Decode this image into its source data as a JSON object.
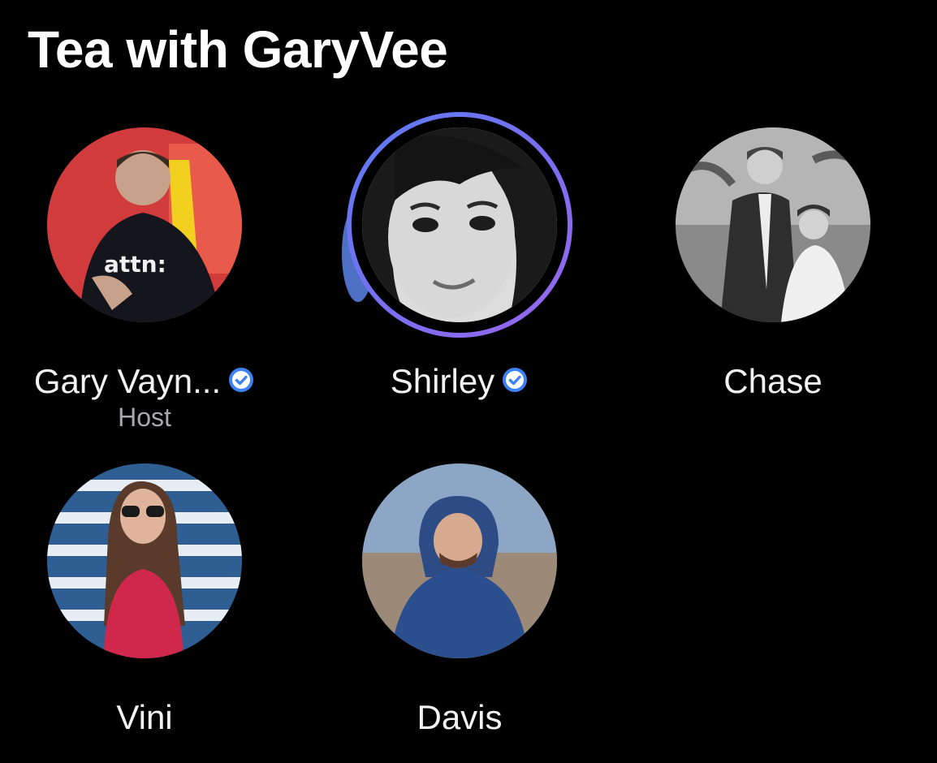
{
  "room": {
    "title": "Tea with GaryVee"
  },
  "colors": {
    "background": "#000000",
    "text": "#f2f2f2",
    "secondary_text": "#a9a9ad",
    "verified_badge": "#3b82f6",
    "speaking_ring": "#7b6ef0"
  },
  "speakers": [
    {
      "name": "Gary Vayn...",
      "verified": true,
      "role": "Host",
      "speaking": false,
      "avatar_icon": "avatar-photo"
    },
    {
      "name": "Shirley",
      "verified": true,
      "role": "",
      "speaking": true,
      "avatar_icon": "avatar-photo"
    },
    {
      "name": "Chase",
      "verified": false,
      "role": "",
      "speaking": false,
      "avatar_icon": "avatar-photo"
    },
    {
      "name": "Vini",
      "verified": false,
      "role": "",
      "speaking": false,
      "avatar_icon": "avatar-photo"
    },
    {
      "name": "Davis",
      "verified": false,
      "role": "",
      "speaking": false,
      "avatar_icon": "avatar-photo"
    }
  ]
}
